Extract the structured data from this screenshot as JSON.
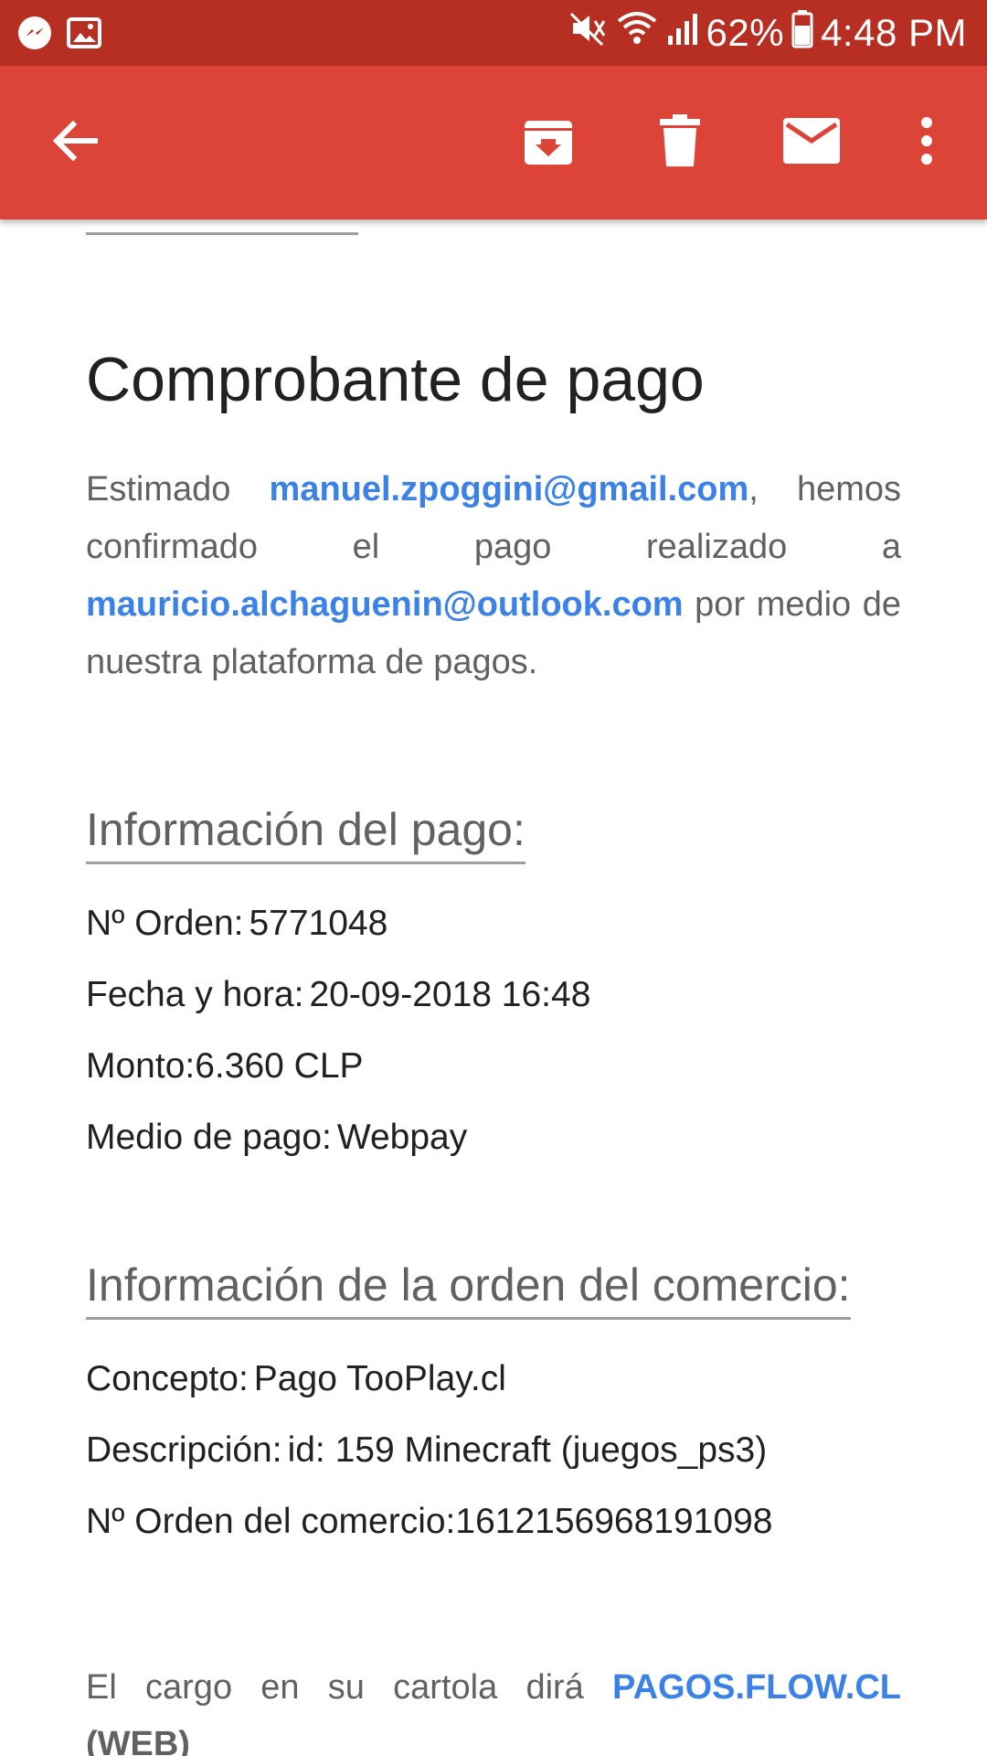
{
  "status_bar": {
    "battery": "62%",
    "time": "4:48 PM",
    "icons_left": [
      "messenger-icon",
      "gallery-icon"
    ],
    "icons_right": [
      "mute-icon",
      "wifi-icon",
      "signal-icon",
      "battery-icon"
    ]
  },
  "app_bar": {
    "back": "back-arrow-icon",
    "actions": [
      "archive-icon",
      "delete-icon",
      "mark-unread-icon",
      "more-vert-icon"
    ]
  },
  "email": {
    "title": "Comprobante de pago",
    "intro": {
      "part1": "Estimado",
      "payer_email": "manuel.zpoggini@gmail.com",
      "part2": ", hemos confirmado el pago realizado a",
      "recipient_email": "mauricio.alchaguenin@outlook.com",
      "part3": "por medio de nuestra plataforma de pagos."
    },
    "payment_info": {
      "heading": "Información del pago:",
      "rows": [
        {
          "label": "Nº Orden:",
          "value": "5771048"
        },
        {
          "label": "Fecha y hora:",
          "value": "20-09-2018 16:48"
        },
        {
          "label": "Monto:",
          "value": "6.360 CLP"
        },
        {
          "label": "Medio de pago:",
          "value": "Webpay"
        }
      ]
    },
    "merchant_info": {
      "heading": "Información de la orden del comercio:",
      "rows": [
        {
          "label": "Concepto:",
          "value": "Pago TooPlay.cl"
        },
        {
          "label": "Descripción:",
          "value": "id: 159 Minecraft (juegos_ps3)"
        },
        {
          "label": "Nº Orden del comercio:",
          "value": "1612156968191098"
        }
      ]
    },
    "charge_note": {
      "text": "El cargo en su cartola dirá",
      "link": "PAGOS.FLOW.CL",
      "suffix": "(WEB)"
    }
  },
  "colors": {
    "status_bar": "#b72f22",
    "app_bar": "#db4437",
    "link": "#3b82e8"
  }
}
